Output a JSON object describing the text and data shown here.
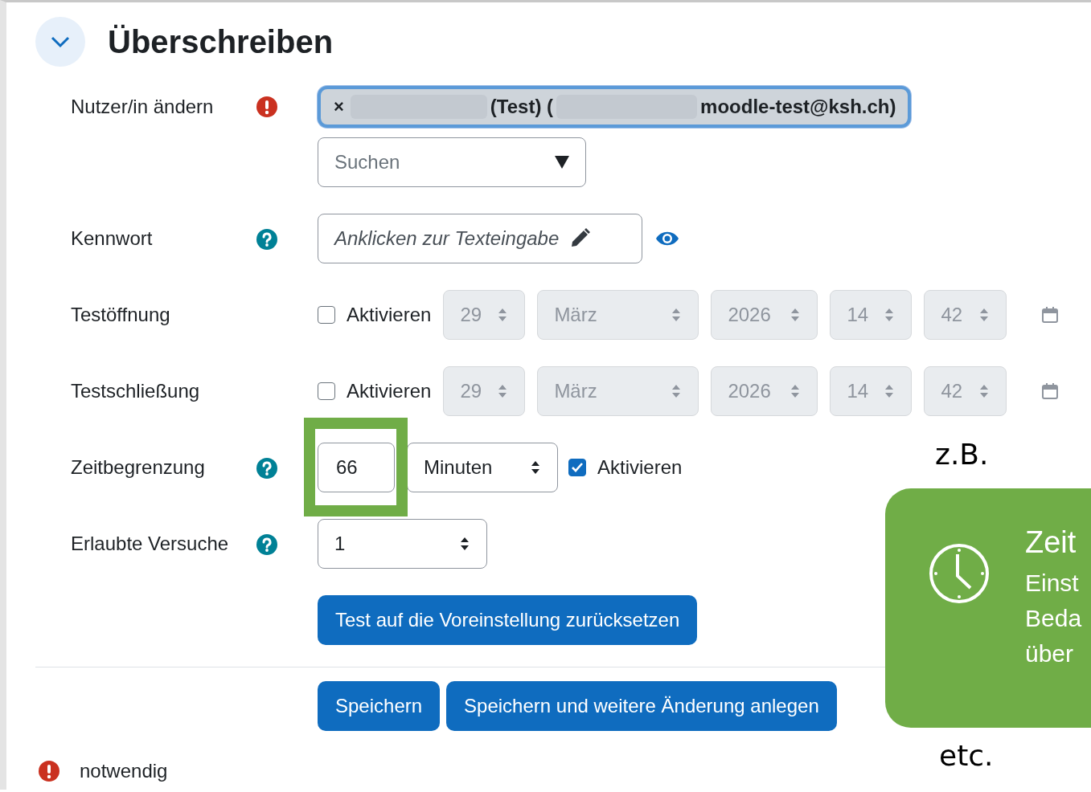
{
  "section": {
    "title": "Überschreiben",
    "expanded": true
  },
  "fields": [
    {
      "kind": "user",
      "label": "Nutzer/in ändern",
      "required": true,
      "chip": {
        "remove": "×",
        "segments": [
          {
            "kind": "redacted"
          },
          {
            "kind": "text",
            "text": "(Test) ("
          },
          {
            "kind": "redacted"
          },
          {
            "kind": "text",
            "text": "moodle-test@ksh.ch)"
          }
        ]
      },
      "search": {
        "placeholder": "Suchen"
      }
    },
    {
      "kind": "password",
      "label": "Kennwort",
      "help": true,
      "prompt": "Anklicken zur Texteingabe"
    },
    {
      "kind": "date",
      "label": "Testöffnung",
      "enable": {
        "label": "Aktivieren",
        "checked": false
      },
      "selects": [
        "29",
        "März",
        "2026",
        "14",
        "42"
      ]
    },
    {
      "kind": "date",
      "label": "Testschließung",
      "enable": {
        "label": "Aktivieren",
        "checked": false
      },
      "selects": [
        "29",
        "März",
        "2026",
        "14",
        "42"
      ]
    },
    {
      "kind": "duration",
      "label": "Zeitbegrenzung",
      "help": true,
      "value": "66",
      "highlighted": true,
      "unit": "Minuten",
      "enable": {
        "label": "Aktivieren",
        "checked": true
      }
    },
    {
      "kind": "select",
      "label": "Erlaubte Versuche",
      "help": true,
      "value": "1"
    }
  ],
  "reset_button": "Test auf die Voreinstellung zurücksetzen",
  "buttons": [
    "Speichern",
    "Speichern und weitere Änderung anlegen"
  ],
  "required_note": "notwendig",
  "callout": {
    "note_above": "z.B.",
    "title": "Zeit",
    "lines": [
      "Einst",
      "Beda",
      "über"
    ],
    "note_below": "etc."
  }
}
